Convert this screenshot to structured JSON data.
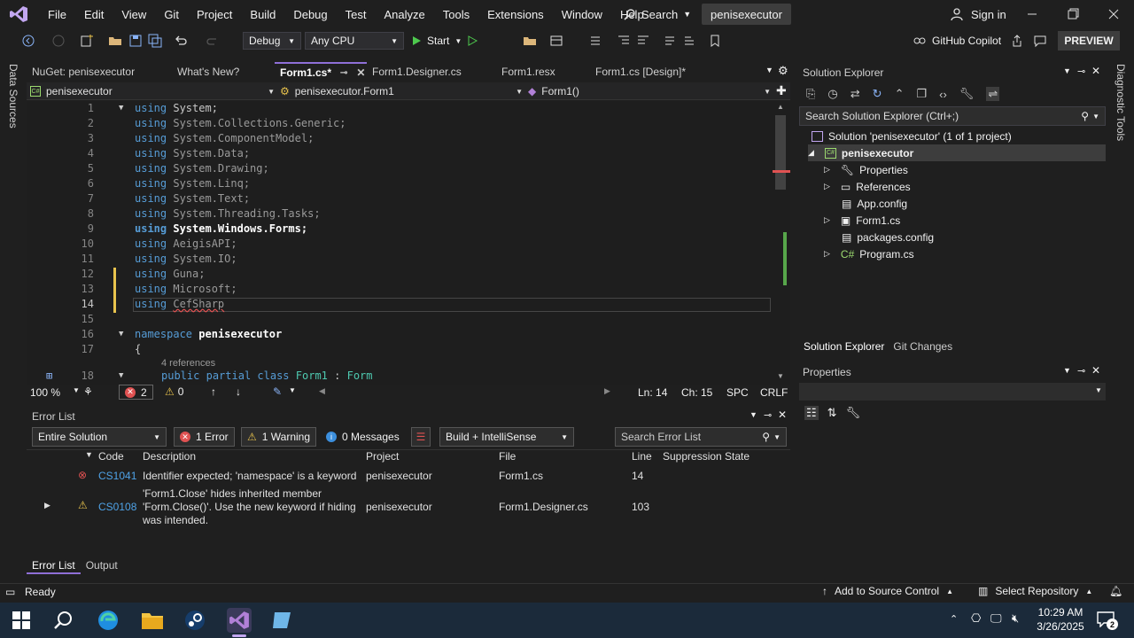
{
  "menu": [
    "File",
    "Edit",
    "View",
    "Git",
    "Project",
    "Build",
    "Debug",
    "Test",
    "Analyze",
    "Tools",
    "Extensions",
    "Window",
    "Help"
  ],
  "search_label": "Search",
  "solution_name": "penisexecutor",
  "signin": "Sign in",
  "toolbar": {
    "config": "Debug",
    "platform": "Any CPU",
    "start": "Start",
    "copilot": "GitHub Copilot",
    "preview": "PREVIEW"
  },
  "left_strip": {
    "data_sources": "Data Sources"
  },
  "right_strip": {
    "diagnostic_tools": "Diagnostic Tools"
  },
  "tabs": [
    {
      "label": "NuGet: penisexecutor"
    },
    {
      "label": "What's New?"
    },
    {
      "label": "Form1.cs*"
    },
    {
      "label": "Form1.Designer.cs"
    },
    {
      "label": "Form1.resx"
    },
    {
      "label": "Form1.cs [Design]*"
    }
  ],
  "nav": {
    "project": "penisexecutor",
    "class": "penisexecutor.Form1",
    "member": "Form1()"
  },
  "code": {
    "kw_using": "using",
    "kw_namespace": "namespace",
    "kw_public": "public",
    "kw_partial": "partial",
    "kw_class": "class",
    "lines": [
      {
        "n": "1",
        "ns": "System",
        "semi": ";"
      },
      {
        "n": "2",
        "ns": "System.Collections.Generic",
        "semi": ";"
      },
      {
        "n": "3",
        "ns": "System.ComponentModel",
        "semi": ";"
      },
      {
        "n": "4",
        "ns": "System.Data",
        "semi": ";"
      },
      {
        "n": "5",
        "ns": "System.Drawing",
        "semi": ";"
      },
      {
        "n": "6",
        "ns": "System.Linq",
        "semi": ";"
      },
      {
        "n": "7",
        "ns": "System.Text",
        "semi": ";"
      },
      {
        "n": "8",
        "ns": "System.Threading.Tasks",
        "semi": ";"
      },
      {
        "n": "9",
        "ns": "System.Windows.Forms",
        "semi": ";"
      },
      {
        "n": "10",
        "ns": "AeigisAPI",
        "semi": ";"
      },
      {
        "n": "11",
        "ns": "System.IO",
        "semi": ";"
      },
      {
        "n": "12",
        "ns": "Guna",
        "semi": ";"
      },
      {
        "n": "13",
        "ns": "Microsoft",
        "semi": ";"
      },
      {
        "n": "14",
        "ns": "CefSharp",
        "semi": ""
      }
    ],
    "line15": "15",
    "line16": "16",
    "line17": "17",
    "line18": "18",
    "namespace_name": "penisexecutor",
    "brace": "{",
    "refs": "4 references",
    "class_name": "Form1",
    "class_sep": ":",
    "base": "Form"
  },
  "editor_status": {
    "zoom": "100 %",
    "errors": "2",
    "warnings": "0",
    "ln": "Ln: 14",
    "ch": "Ch: 15",
    "spc": "SPC",
    "crlf": "CRLF"
  },
  "error_list": {
    "title": "Error List",
    "scope": "Entire Solution",
    "errors_btn": "1 Error",
    "warnings_btn": "1 Warning",
    "messages_btn": "0 Messages",
    "build_filter": "Build + IntelliSense",
    "search_placeholder": "Search Error List",
    "headers": {
      "code": "Code",
      "description": "Description",
      "project": "Project",
      "file": "File",
      "line": "Line",
      "suppression": "Suppression State"
    },
    "rows": [
      {
        "code": "CS1041",
        "description": "Identifier expected; 'namespace' is a keyword",
        "project": "penisexecutor",
        "file": "Form1.cs",
        "line": "14"
      },
      {
        "code": "CS0108",
        "desc1": "'Form1.Close' hides inherited member",
        "desc2": "'Form.Close()'. Use the new keyword if hiding",
        "desc3": "was intended.",
        "project": "penisexecutor",
        "file": "Form1.Designer.cs",
        "line": "103"
      }
    ]
  },
  "bottom_tabs": [
    "Error List",
    "Output"
  ],
  "solution_explorer": {
    "title": "Solution Explorer",
    "search_placeholder": "Search Solution Explorer (Ctrl+;)",
    "solution": "Solution 'penisexecutor' (1 of 1 project)",
    "project": "penisexecutor",
    "items": [
      "Properties",
      "References",
      "App.config",
      "Form1.cs",
      "packages.config",
      "Program.cs"
    ],
    "tabs": [
      "Solution Explorer",
      "Git Changes"
    ]
  },
  "properties": {
    "title": "Properties"
  },
  "statusbar": {
    "ready": "Ready",
    "source_control": "Add to Source Control",
    "repo": "Select Repository"
  },
  "taskbar": {
    "time": "10:29 AM",
    "date": "3/26/2025",
    "notif": "2"
  }
}
